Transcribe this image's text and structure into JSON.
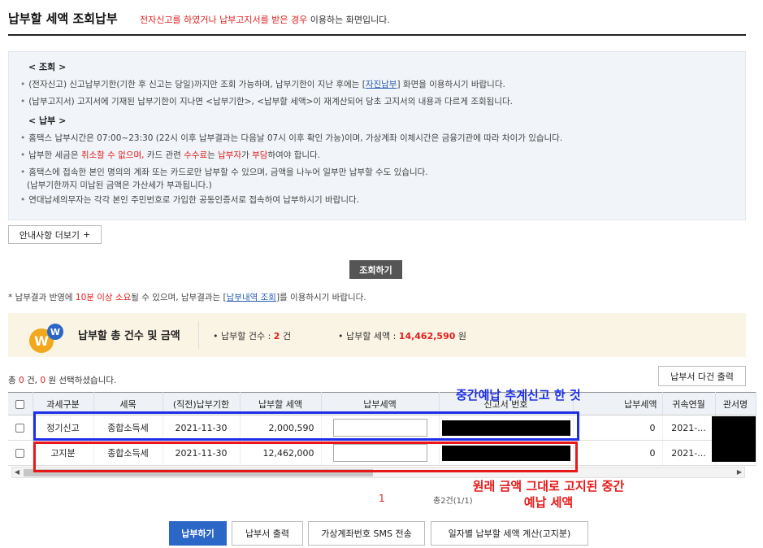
{
  "header": {
    "title": "납부할 세액 조회납부",
    "sub_red": "전자신고를 하였거나 납부고지서를 받은 경우",
    "sub_rest": " 이용하는 화면입니다."
  },
  "notice": {
    "inquiry_head": "< 조회 >",
    "inquiry_lines": [
      {
        "pre": "(전자신고) 신고납부기한(기한 후 신고는 당일)까지만 조회 가능하며, 납부기한이 지난 후에는 [",
        "link": "자진납부",
        "post": "] 화면을 이용하시기 바랍니다."
      },
      {
        "text": "(납부고지서) 고지서에 기재된 납부기한이 지나면 <납부기한>, <납부할 세액>이 재계산되어 당초 고지서의 내용과 다르게 조회됩니다."
      }
    ],
    "pay_head": "< 납부 >",
    "pay_line1": "홈택스 납부시간은 07:00~23:30 (22시 이후 납부결과는 다음날 07시 이후 확인 가능)이며, 가상계좌 이체시간은 금융기관에 따라 차이가 있습니다.",
    "pay_line2": {
      "p1": "납부한 세금은 ",
      "r1": "취소할 수 없으며,",
      "p2": " 카드 관련 ",
      "r2": "수수료",
      "p3": "는 ",
      "r3": "납부자",
      "p4": "가 ",
      "r4": "부담",
      "p5": "하여야 합니다."
    },
    "pay_line3a": "홈택스에 접속한 본인 명의의 계좌 또는 카드로만 납부할 수 있으며, 금액을 나누어 일부만 납부할 수도 있습니다.",
    "pay_line3b": "(납부기한까지 미납된 금액은 가산세가 부과됩니다.)",
    "pay_line4": "연대납세의무자는 각각 본인 주민번호로 가입한 공동인증서로 접속하여 납부하시기 바랍니다."
  },
  "buttons": {
    "more": "안내사항 더보기",
    "more_icon": "+",
    "search": "조회하기",
    "print_multi": "납부서 다건 출력",
    "pay": "납부하기",
    "print": "납부서 출력",
    "sms": "가상계좌번호 SMS 전송",
    "daily": "일자별 납부할 세액 계산(고지분)"
  },
  "result_note": {
    "p1": "납부결과 반영에 ",
    "r1": "10분 이상 소요",
    "p2": "될 수 있으며, 납부결과는 [",
    "link": "납부내역 조회",
    "p3": "]를 이용하시기 바랍니다."
  },
  "summary": {
    "label": "납부할 총 건수 및 금액",
    "count_label": "납부할 건수 : ",
    "count_value": "2",
    "count_unit": " 건",
    "amount_label": "납부할 세액 : ",
    "amount_value": "14,462,590",
    "amount_unit": " 원"
  },
  "selection": {
    "p1": "총 ",
    "count": "0",
    "p2": " 건, ",
    "amount": "0",
    "p3": " 원 선택하셨습니다."
  },
  "table": {
    "headers": [
      "",
      "과세구분",
      "세목",
      "(직전)납부기한",
      "납부할 세액",
      "납부세액",
      "신고서 번호",
      "납부세액",
      "귀속연월",
      "관서명"
    ],
    "rows": [
      {
        "type": "정기신고",
        "item": "종합소득세",
        "due": "2021-11-30",
        "amount": "2,000,590",
        "pay": "0",
        "period": "2021-..."
      },
      {
        "type": "고지분",
        "item": "종합소득세",
        "due": "2021-11-30",
        "amount": "12,462,000",
        "pay": "0",
        "period": "2021-..."
      }
    ]
  },
  "annotations": {
    "blue": "중간예납 추계신고 한 것",
    "red": "원래 금액 그대로 고지된 중간예납 세액"
  },
  "pagination": {
    "current": "1",
    "total": "총2건(1/1)"
  },
  "colors": {
    "accent": "#2b67c6",
    "red": "#e02020",
    "blue_annot": "#1d2ee6",
    "red_annot": "#e81818"
  }
}
